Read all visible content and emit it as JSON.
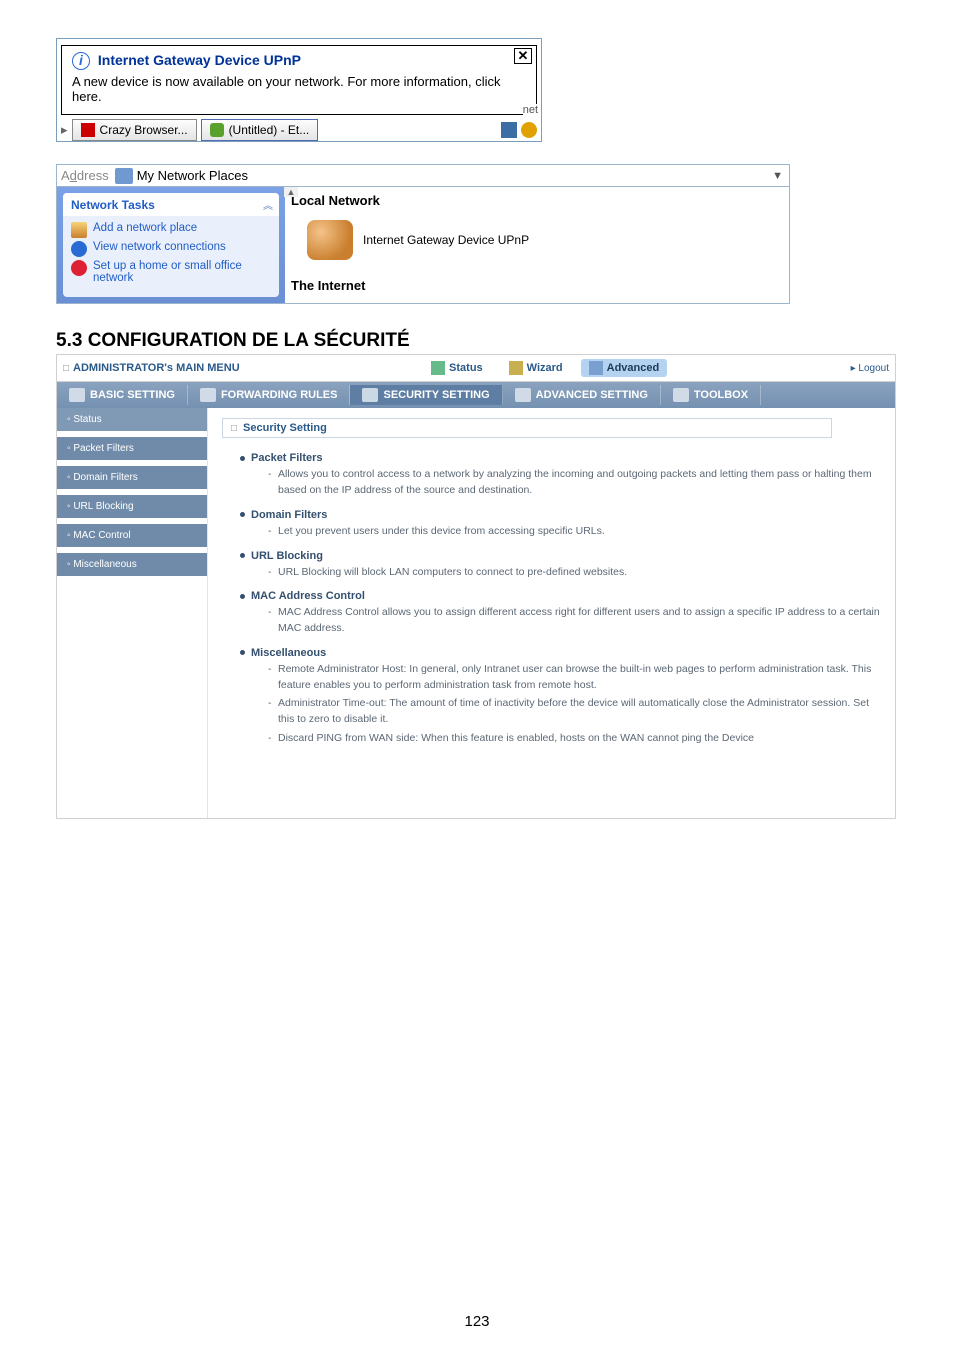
{
  "balloon": {
    "title": "Internet Gateway Device UPnP",
    "body": "A new device is now available on your network. For more information, click here.",
    "tail_label": "net"
  },
  "taskbar": {
    "buttons": [
      {
        "label": "Crazy Browser..."
      },
      {
        "label": "(Untitled) - Et..."
      }
    ]
  },
  "addressbar": {
    "label": "Address",
    "value": "My Network Places"
  },
  "network_tasks": {
    "header": "Network Tasks",
    "items": [
      {
        "label": "Add a network place"
      },
      {
        "label": "View network connections"
      },
      {
        "label": "Set up a home or small office network"
      }
    ]
  },
  "local_network": {
    "header": "Local Network",
    "item": "Internet Gateway Device UPnP",
    "footer": "The Internet"
  },
  "section_heading": "5.3 CONFIGURATION DE LA SÉCURITÉ",
  "router": {
    "menu_label": "ADMINISTRATOR's MAIN MENU",
    "logout": "▸ Logout",
    "top_tabs": {
      "status": "Status",
      "wizard": "Wizard",
      "advanced": "Advanced"
    },
    "sub_tabs": {
      "basic": "BASIC SETTING",
      "forwarding": "FORWARDING RULES",
      "security": "SECURITY SETTING",
      "advanced": "ADVANCED SETTING",
      "toolbox": "TOOLBOX"
    },
    "nav": [
      "Status",
      "Packet Filters",
      "Domain Filters",
      "URL Blocking",
      "MAC Control",
      "Miscellaneous"
    ],
    "content": {
      "title": "Security Setting",
      "sections": [
        {
          "title": "Packet Filters",
          "items": [
            "Allows you to control access to a network by analyzing the incoming and outgoing packets and letting them pass or halting them based on the IP address of the source and destination."
          ]
        },
        {
          "title": "Domain Filters",
          "items": [
            "Let you prevent users under this device from accessing specific URLs."
          ]
        },
        {
          "title": "URL Blocking",
          "items": [
            "URL Blocking will block LAN computers to connect to pre-defined websites."
          ]
        },
        {
          "title": "MAC Address Control",
          "items": [
            "MAC Address Control allows you to assign different access right for different users and to assign a specific IP address to a certain MAC address."
          ]
        },
        {
          "title": "Miscellaneous",
          "items": [
            "Remote Administrator Host: In general, only Intranet user can browse the built-in web pages to perform administration task. This feature enables you to perform administration task from remote host.",
            "Administrator Time-out: The amount of time of inactivity before the device will automatically close the Administrator session. Set this to zero to disable it.",
            "Discard PING from WAN side: When this feature is enabled, hosts on the WAN cannot ping the Device"
          ]
        }
      ]
    }
  },
  "page_number": "123"
}
